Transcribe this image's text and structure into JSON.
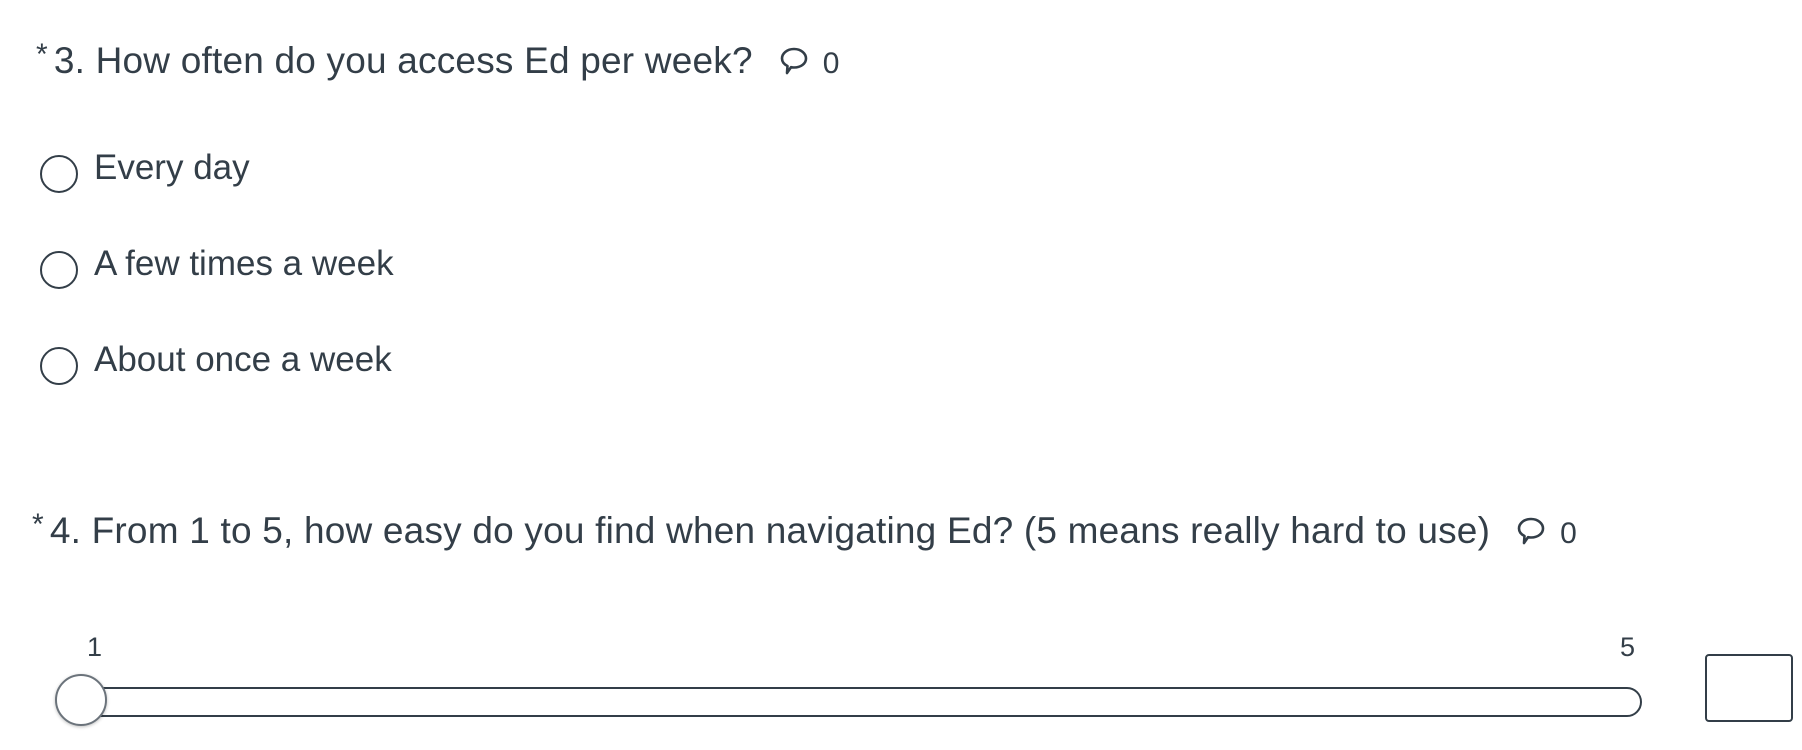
{
  "questions": [
    {
      "required_marker": "*",
      "title": "3. How often do you access Ed per week?",
      "comment_count": "0",
      "options": [
        {
          "label": "Every day"
        },
        {
          "label": "A few times a week"
        },
        {
          "label": "About once a week"
        }
      ]
    },
    {
      "required_marker": "*",
      "title": "4. From 1 to 5, how easy do you find when navigating Ed? (5 means really hard to use)",
      "comment_count": "0",
      "slider": {
        "min_label": "1",
        "max_label": "5",
        "min": 1,
        "max": 5,
        "value": 1,
        "input_value": ""
      }
    }
  ],
  "icons": {
    "comment": "speech-bubble-icon"
  },
  "colors": {
    "text": "#333e48",
    "border": "#333e48"
  }
}
